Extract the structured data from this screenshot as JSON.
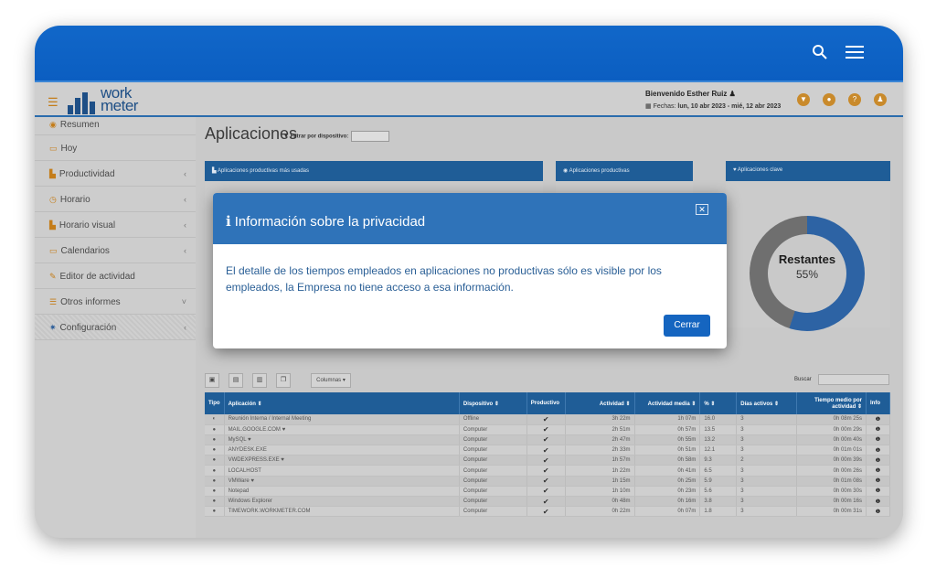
{
  "header": {
    "welcome": "Bienvenido Esther Ruiz",
    "dates_label": "Fechas:",
    "dates_value": "lun, 10 abr 2023 - mié, 12 abr 2023",
    "logo_line1": "work",
    "logo_line2": "meter"
  },
  "sidebar": {
    "items": [
      {
        "label": "Resumen",
        "icon": "dashboard-icon"
      },
      {
        "label": "Hoy",
        "icon": "calendar-icon"
      },
      {
        "label": "Productividad",
        "icon": "bar-chart-icon"
      },
      {
        "label": "Horario",
        "icon": "clock-icon"
      },
      {
        "label": "Horario visual",
        "icon": "bar-chart-icon"
      },
      {
        "label": "Calendarios",
        "icon": "calendar-icon"
      },
      {
        "label": "Editor de actividad",
        "icon": "edit-icon"
      },
      {
        "label": "Otros informes",
        "icon": "list-icon"
      },
      {
        "label": "Configuración",
        "icon": "gear-icon"
      }
    ]
  },
  "main": {
    "title": "Aplicaciones",
    "filter_label": "Filtrar por dispositivo:",
    "panels": [
      "Aplicaciones productivas más usadas",
      "Aplicaciones productivas",
      "Aplicaciones clave"
    ],
    "donut": {
      "label": "Restantes",
      "percent": "55%",
      "value": 55
    },
    "columns_button": "Columnas",
    "search_label": "Buscar"
  },
  "table": {
    "headers": [
      "Tipo",
      "Aplicación",
      "Dispositivo",
      "Productivo",
      "Actividad",
      "Actividad media",
      "%",
      "Días activos",
      "Tiempo medio por actividad",
      "Info"
    ],
    "rows": [
      {
        "app": "Reunión Interna / Internal Meeting",
        "device": "Offline",
        "act": "3h 22m",
        "avg": "1h 07m",
        "pct": "16.0",
        "days": "3",
        "mean": "0h 08m 25s"
      },
      {
        "app": "MAIL.GOOGLE.COM",
        "device": "Computer",
        "act": "2h 51m",
        "avg": "0h 57m",
        "pct": "13.5",
        "days": "3",
        "mean": "0h 00m 29s"
      },
      {
        "app": "MySQL",
        "device": "Computer",
        "act": "2h 47m",
        "avg": "0h 55m",
        "pct": "13.2",
        "days": "3",
        "mean": "0h 00m 40s"
      },
      {
        "app": "ANYDESK.EXE",
        "device": "Computer",
        "act": "2h 33m",
        "avg": "0h 51m",
        "pct": "12.1",
        "days": "3",
        "mean": "0h 01m 01s"
      },
      {
        "app": "VWDEXPRESS.EXE",
        "device": "Computer",
        "act": "1h 57m",
        "avg": "0h 58m",
        "pct": "9.3",
        "days": "2",
        "mean": "0h 00m 39s"
      },
      {
        "app": "LOCALHOST",
        "device": "Computer",
        "act": "1h 22m",
        "avg": "0h 41m",
        "pct": "6.5",
        "days": "3",
        "mean": "0h 00m 26s"
      },
      {
        "app": "VMWare",
        "device": "Computer",
        "act": "1h 15m",
        "avg": "0h 25m",
        "pct": "5.9",
        "days": "3",
        "mean": "0h 01m 08s"
      },
      {
        "app": "Notepad",
        "device": "Computer",
        "act": "1h 10m",
        "avg": "0h 23m",
        "pct": "5.6",
        "days": "3",
        "mean": "0h 00m 30s"
      },
      {
        "app": "Windows Explorer",
        "device": "Computer",
        "act": "0h 48m",
        "avg": "0h 16m",
        "pct": "3.8",
        "days": "3",
        "mean": "0h 00m 16s"
      },
      {
        "app": "TIMEWORK.WORKMETER.COM",
        "device": "Computer",
        "act": "0h 22m",
        "avg": "0h 07m",
        "pct": "1.8",
        "days": "3",
        "mean": "0h 00m 31s"
      }
    ]
  },
  "modal": {
    "title": "Información sobre la privacidad",
    "body": "El detalle de los tiempos empleados en aplicaciones no productivas sólo es visible por los empleados, la Empresa no tiene acceso a esa información.",
    "close_button": "Cerrar"
  },
  "colors": {
    "topbar": "#0b5ec1",
    "accent": "#1565c0",
    "orange": "#c98a2b"
  }
}
